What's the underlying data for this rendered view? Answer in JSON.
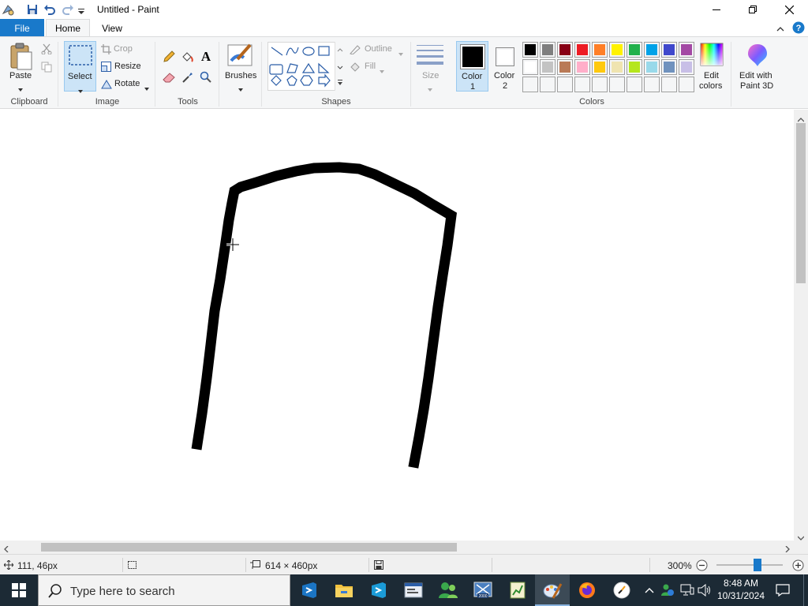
{
  "window": {
    "title": "Untitled - Paint"
  },
  "tabs": {
    "file": "File",
    "home": "Home",
    "view": "View"
  },
  "ribbon": {
    "clipboard": {
      "paste": "Paste",
      "label": "Clipboard"
    },
    "image": {
      "select": "Select",
      "crop": "Crop",
      "resize": "Resize",
      "rotate": "Rotate",
      "label": "Image"
    },
    "tools": {
      "label": "Tools"
    },
    "brushes": {
      "label": "Brushes"
    },
    "shapes": {
      "outline": "Outline",
      "fill": "Fill",
      "label": "Shapes"
    },
    "size": {
      "label": "Size"
    },
    "colors": {
      "color1_line1": "Color",
      "color1_line2": "1",
      "color2_line1": "Color",
      "color2_line2": "2",
      "edit_line1": "Edit",
      "edit_line2": "colors",
      "paint3d_line1": "Edit with",
      "paint3d_line2": "Paint 3D",
      "label": "Colors",
      "color1_value": "#000000",
      "color2_value": "#ffffff",
      "palette_row1": [
        "#000000",
        "#7f7f7f",
        "#880015",
        "#ed1c24",
        "#ff7f27",
        "#fff200",
        "#22b14c",
        "#00a2e8",
        "#3f48cc",
        "#a349a4"
      ],
      "palette_row2": [
        "#ffffff",
        "#c3c3c3",
        "#b97a57",
        "#ffaec9",
        "#ffc90e",
        "#efe4b0",
        "#b5e61d",
        "#99d9ea",
        "#7092be",
        "#c8bfe7"
      ]
    }
  },
  "status": {
    "cursor_pos": "111, 46px",
    "canvas_size": "614 × 460px",
    "zoom": "300%",
    "zoom_fraction": 0.62
  },
  "taskbar": {
    "search_placeholder": "Type here to search",
    "time": "8:48 AM",
    "date": "10/31/2024"
  }
}
